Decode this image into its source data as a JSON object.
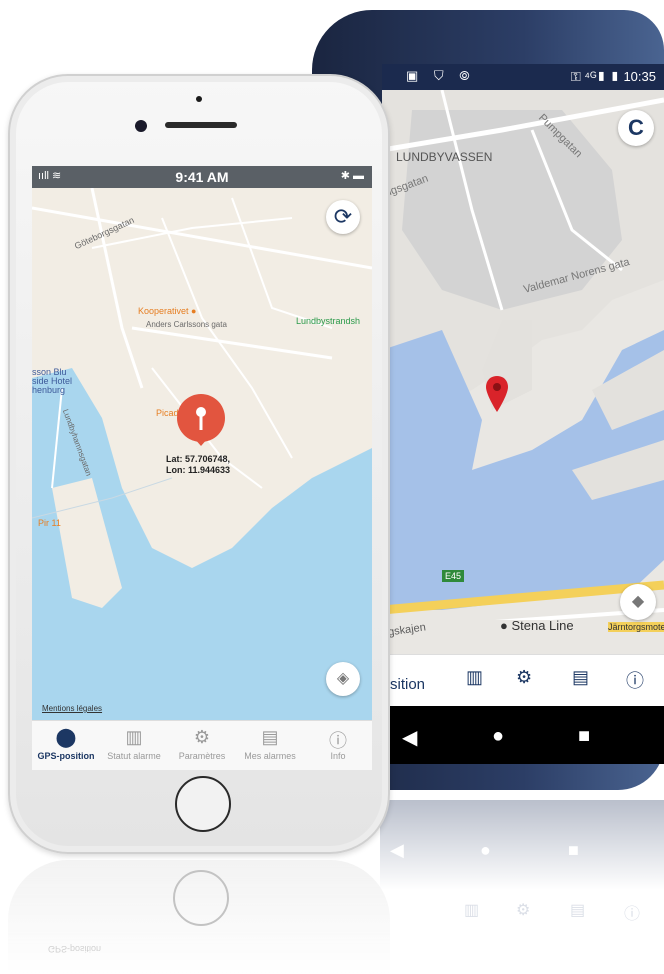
{
  "android": {
    "status": {
      "left_icons": "▣ ⛉ ⦾",
      "right_icons": "⚿ ⁴ᴳ▮ ▮",
      "time": "10:35"
    },
    "map_labels": {
      "district": "LUNDBYVASSEN",
      "street1": "Pumpgatan",
      "street2": "Valdemar Norens gata",
      "street3": "ngsgatan",
      "road": "E45",
      "quay": "gskajen",
      "place": "Stena Line",
      "street4": "Järntorgsmotet"
    },
    "tab_partial_label": "sition",
    "icons": {
      "refresh": "C",
      "layers": "◆",
      "chart": "▥",
      "gear": "⚙",
      "alarms": "▤",
      "info": "ⓘ",
      "back": "◀",
      "home": "●",
      "recent": "■",
      "pin": "📍"
    }
  },
  "iphone": {
    "status": {
      "signal": "ııll ≋",
      "time": "9:41 AM",
      "battery": "✱ ▬"
    },
    "map_labels": {
      "street1": "Göteborgsgatan",
      "street2": "Anders Carlssons gata",
      "shop": "Kooperativet",
      "park": "Lundbystrandsh",
      "hotel": "sson Blu\nside Hotel\nhenburg",
      "cafe": "Picade",
      "pier": "Pir 11",
      "street3": "Lundbyhamnsgatan"
    },
    "coords": {
      "lat": "Lat: 57.706748,",
      "lon": "Lon: 11.944633"
    },
    "legal": "Mentions légales",
    "tabs": [
      {
        "label": "GPS-position",
        "icon": "⬤"
      },
      {
        "label": "Statut alarme",
        "icon": "▥"
      },
      {
        "label": "Paramètres",
        "icon": "⚙"
      },
      {
        "label": "Mes alarmes",
        "icon": "▤"
      },
      {
        "label": "Info",
        "icon": "ⓘ"
      }
    ],
    "icons": {
      "refresh": "⟳",
      "layers": "◈"
    }
  },
  "colors": {
    "accent": "#1c3763",
    "pin": "#e2553f",
    "water_ios": "#a9d6ee",
    "water_android": "#a5c1e8",
    "land_ios": "#f2ede4",
    "land_android": "#e9e7e3"
  }
}
